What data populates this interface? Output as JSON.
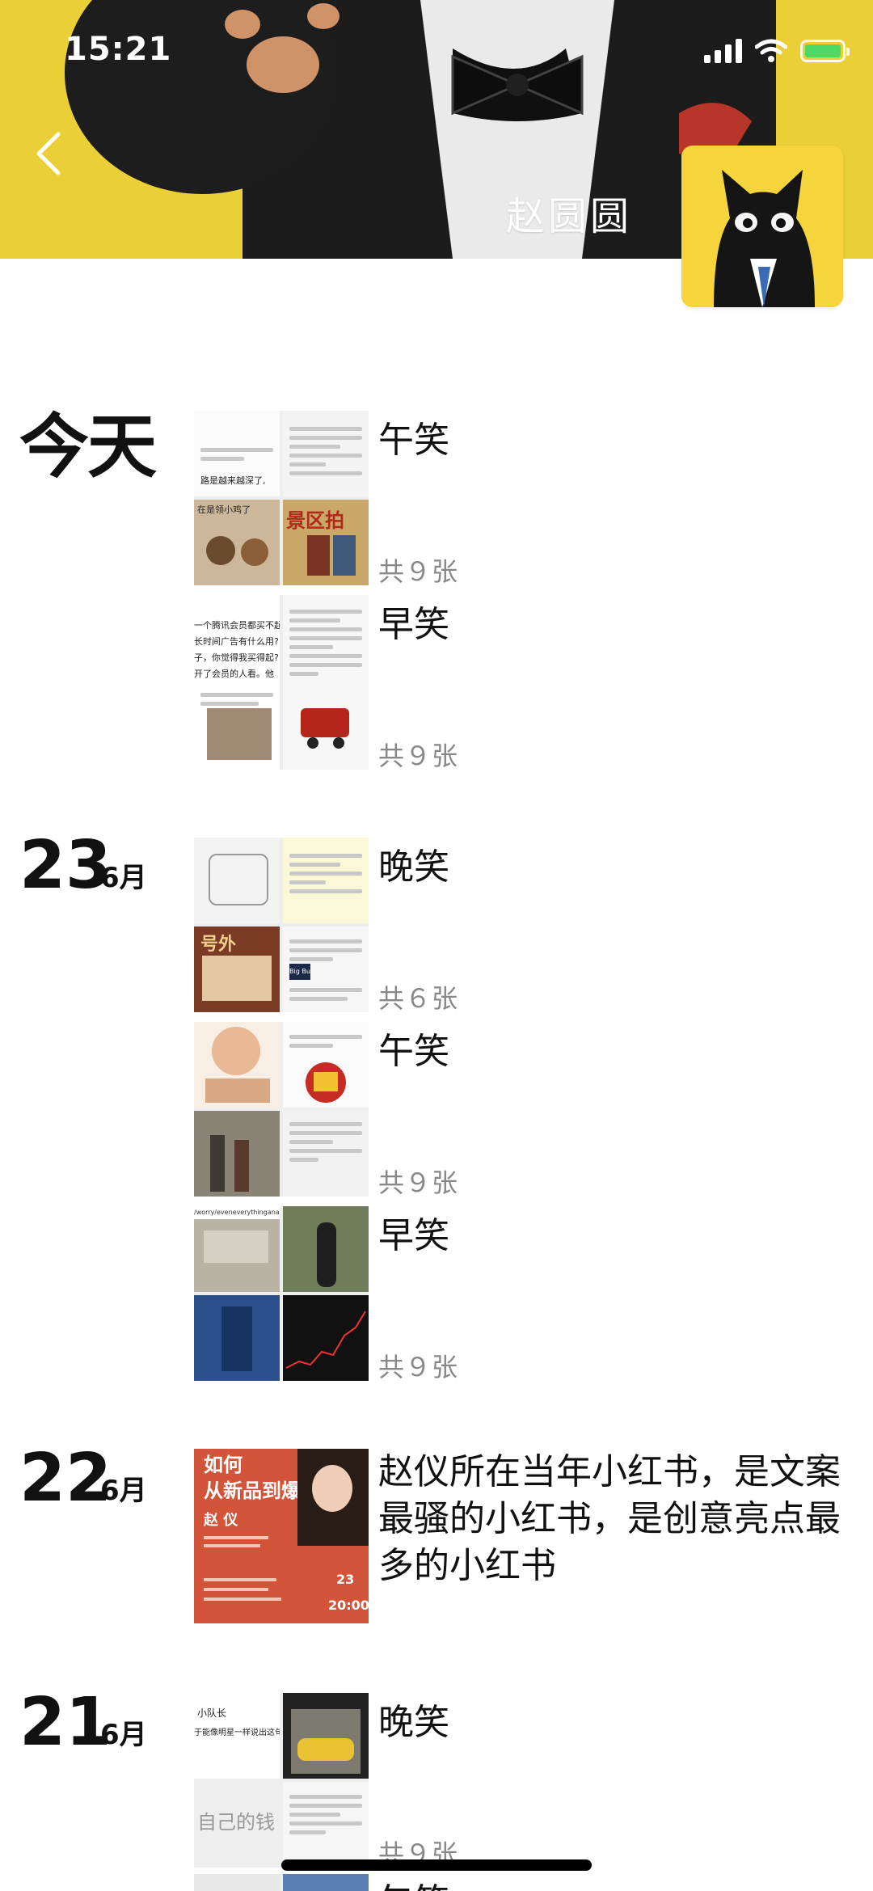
{
  "status_bar": {
    "time": "15:21"
  },
  "header": {
    "name": "赵圆圆",
    "back_icon": "chevron-left-icon",
    "avatar_icon": "black-cat-avatar"
  },
  "groups": [
    {
      "date_label": "今天",
      "entries": [
        {
          "title": "午笑",
          "count": "共９张",
          "thumb_text": [
            "路是越来越深了,",
            "在是领小鸡了",
            "景区拍"
          ]
        },
        {
          "title": "早笑",
          "count": "共９张",
          "thumb_text": [
            "一个腾讯会员都买不起",
            "长时间广告有什么用?",
            "子，你觉得我买得起?",
            "开了会员的人看。他"
          ]
        }
      ]
    },
    {
      "day": "23",
      "month": "6月",
      "entries": [
        {
          "title": "晚笑",
          "count": "共６张",
          "thumb_text": [
            "号外",
            "Big Bu"
          ]
        },
        {
          "title": "午笑",
          "count": "共９张",
          "thumb_text": []
        },
        {
          "title": "早笑",
          "count": "共９张",
          "thumb_text": [
            "/worry/eveneverythinganadmirer"
          ]
        }
      ]
    },
    {
      "day": "22",
      "month": "6月",
      "entries": [
        {
          "text": "赵仪所在当年小红书，是文案最骚的小红书，是创意亮点最多的小红书",
          "poster": {
            "line1": "如何",
            "line2": "从新品到爆品",
            "name": "赵 仪",
            "num": "23",
            "time": "20:00"
          }
        }
      ]
    },
    {
      "day": "21",
      "month": "6月",
      "entries": [
        {
          "title": "晚笑",
          "count": "共９张",
          "thumb_text": [
            "小队长",
            "于能像明星一样说出这句",
            "自己的钱"
          ]
        },
        {
          "title": "午笑"
        }
      ]
    }
  ]
}
